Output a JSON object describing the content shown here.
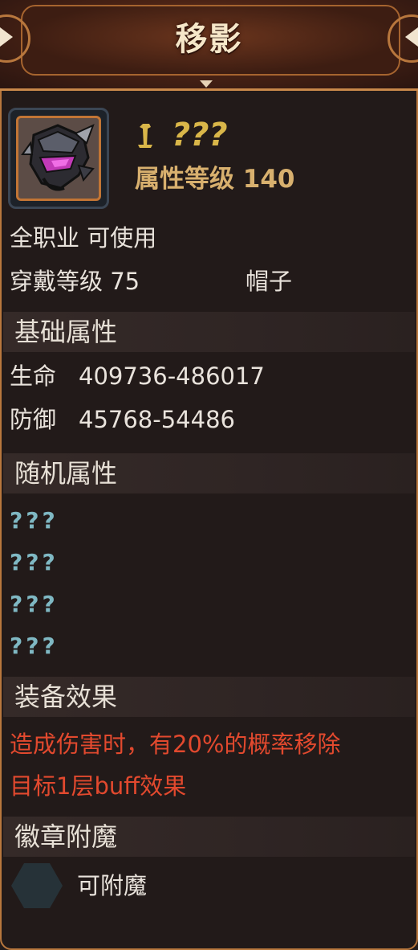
{
  "header": {
    "title": "移影"
  },
  "item": {
    "icon_name": "helmet-icon",
    "weapon_icon_name": "sword-icon",
    "name": "???",
    "attr_level": "属性等级 140",
    "usable": "全职业 可使用",
    "wear_level": "穿戴等级 75",
    "slot": "帽子"
  },
  "basic": {
    "title": "基础属性",
    "stats": [
      {
        "label": "生命",
        "value": "409736-486017"
      },
      {
        "label": "防御",
        "value": "45768-54486"
      }
    ]
  },
  "random": {
    "title": "随机属性",
    "rows": [
      "???",
      "???",
      "???",
      "???"
    ]
  },
  "effect": {
    "title": "装备效果",
    "lines": [
      "造成伤害时，有20%的概率移除",
      "目标1层buff效果"
    ]
  },
  "enchant": {
    "title": "徽章附魔",
    "slot_icon": "hexagon-slot-icon",
    "label": "可附魔"
  },
  "colors": {
    "accent": "#c27535",
    "effect_text": "#e2492e",
    "unknown_text": "#7fb8c3",
    "name_gold": "#d9b649"
  }
}
